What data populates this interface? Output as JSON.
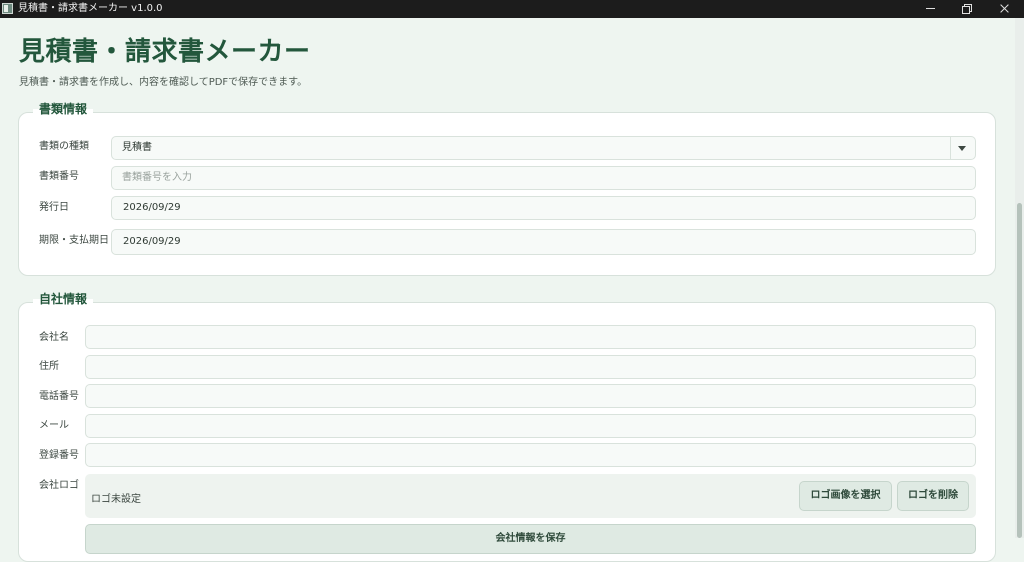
{
  "window": {
    "title": "見積書・請求書メーカー  v1.0.0"
  },
  "header": {
    "title": "見積書・請求書メーカー",
    "subtitle": "見積書・請求書を作成し、内容を確認してPDFで保存できます。"
  },
  "document_section": {
    "title": "書類情報",
    "type_label": "書類の種類",
    "type_value": "見積書",
    "number_label": "書類番号",
    "number_placeholder": "書類番号を入力",
    "issue_date_label": "発行日",
    "issue_date_value": "2026/09/29",
    "due_date_label": "期限・支払期日",
    "due_date_value": "2026/09/29"
  },
  "company_section": {
    "title": "自社情報",
    "name_label": "会社名",
    "name_value": "",
    "address_label": "住所",
    "address_value": "",
    "phone_label": "電話番号",
    "phone_value": "",
    "email_label": "メール",
    "email_value": "",
    "registration_label": "登録番号",
    "registration_value": "",
    "logo_label": "会社ロゴ",
    "logo_status": "ロゴ未設定",
    "select_logo_button": "ロゴ画像を選択",
    "delete_logo_button": "ロゴを削除",
    "save_button": "会社情報を保存"
  },
  "colors": {
    "accent": "#23573c",
    "background": "#eef5f0",
    "card": "#ffffff",
    "button": "#dfeae3"
  }
}
